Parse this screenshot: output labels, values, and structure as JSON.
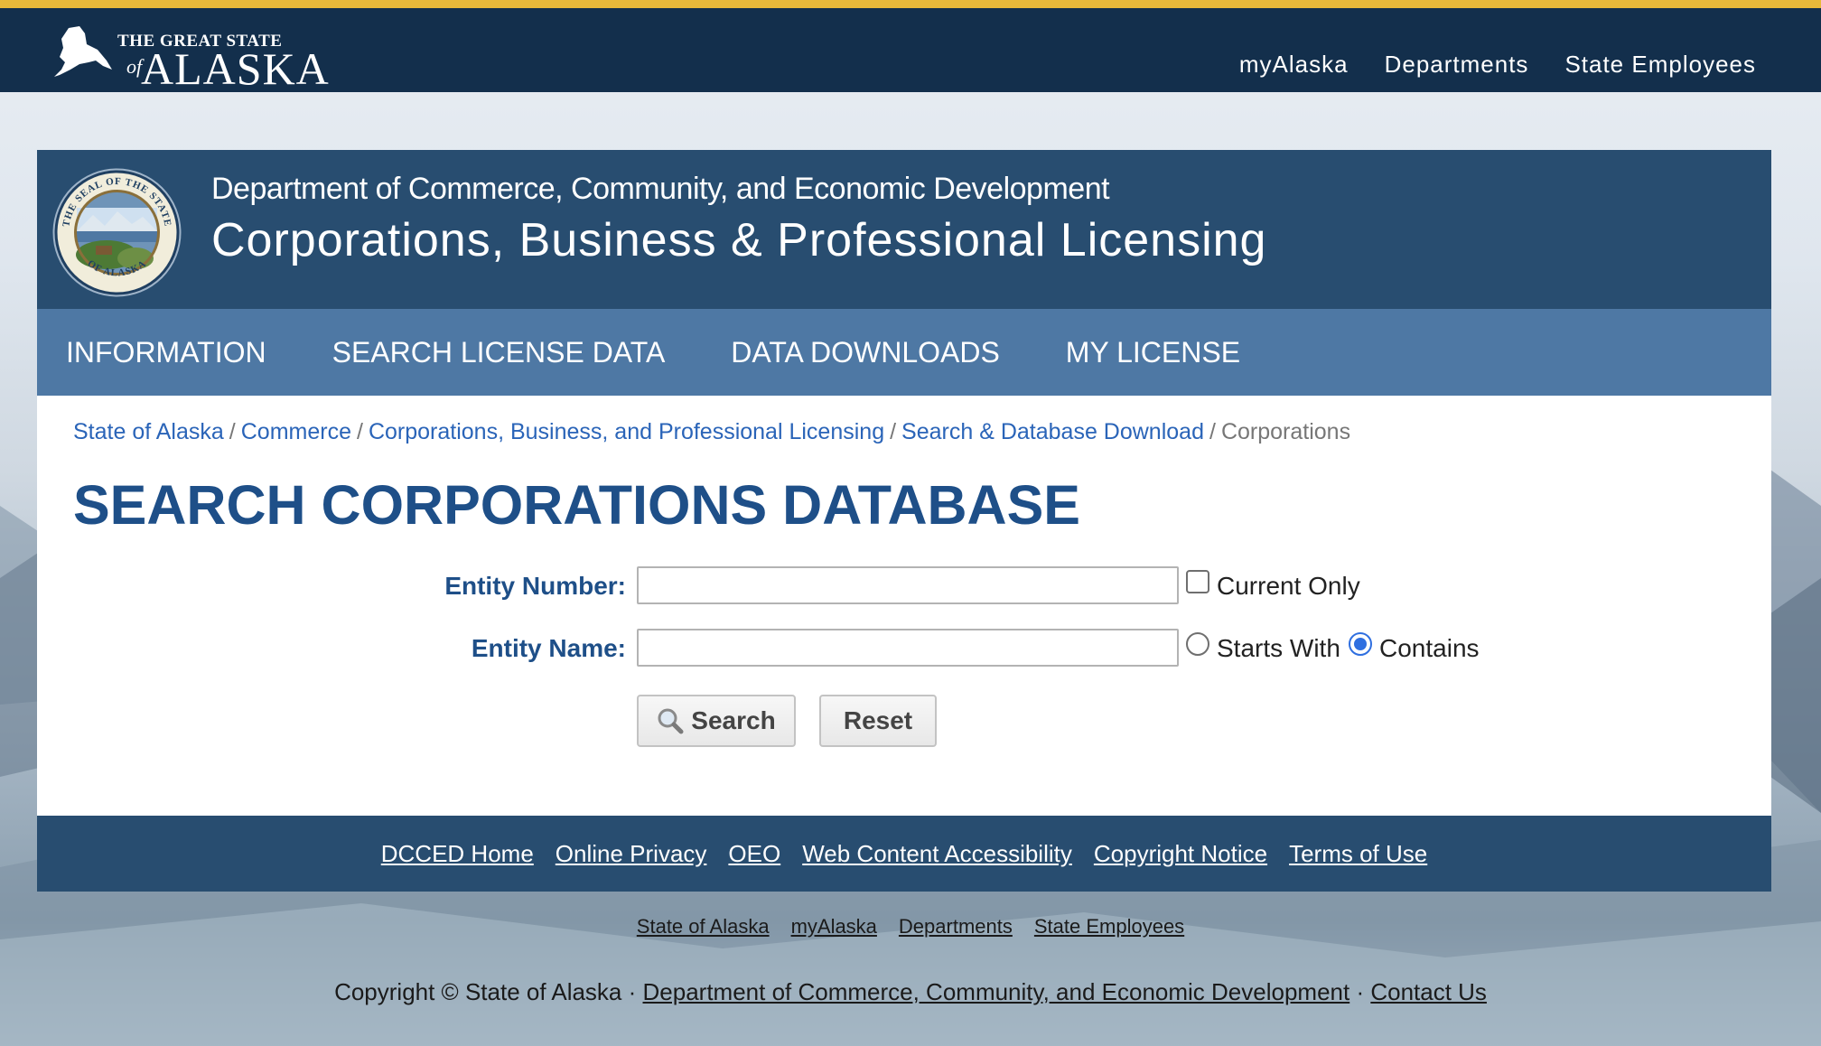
{
  "top_bar": {
    "logo_small": "THE GREAT STATE",
    "logo_of": "of",
    "logo_big": "ALASKA",
    "nav": [
      "myAlaska",
      "Departments",
      "State Employees"
    ]
  },
  "dept_header": {
    "line1": "Department of Commerce, Community, and Economic Development",
    "line2": "Corporations, Business & Professional Licensing",
    "seal_text_top": "THE SEAL OF THE STATE",
    "seal_text_bottom": "OF ALASKA"
  },
  "main_nav": [
    "INFORMATION",
    "SEARCH LICENSE DATA",
    "DATA DOWNLOADS",
    "MY LICENSE"
  ],
  "breadcrumb": {
    "links": [
      "State of Alaska",
      "Commerce",
      "Corporations, Business, and Professional Licensing",
      "Search & Database Download"
    ],
    "current": "Corporations"
  },
  "page_title": "SEARCH CORPORATIONS DATABASE",
  "form": {
    "entity_number_label": "Entity Number:",
    "entity_number_value": "",
    "current_only_label": "Current Only",
    "current_only_checked": false,
    "entity_name_label": "Entity Name:",
    "entity_name_value": "",
    "starts_with_label": "Starts With",
    "contains_label": "Contains",
    "selected_mode": "Contains",
    "search_button": "Search",
    "reset_button": "Reset"
  },
  "footer_links": [
    "DCCED Home",
    "Online Privacy",
    "OEO",
    "Web Content Accessibility",
    "Copyright Notice",
    "Terms of Use"
  ],
  "sub_links": [
    "State of Alaska",
    "myAlaska",
    "Departments",
    "State Employees"
  ],
  "copyright": {
    "prefix": "Copyright © State of Alaska · ",
    "dept_link": "Department of Commerce, Community, and Economic Development",
    "sep": " · ",
    "contact_link": "Contact Us"
  },
  "colors": {
    "top_bar": "#132f4c",
    "gold_accent": "#e8b93a",
    "dept_header": "#284d70",
    "main_nav": "#4e78a4",
    "title_blue": "#1e4f88",
    "link_blue": "#2a64b8"
  }
}
